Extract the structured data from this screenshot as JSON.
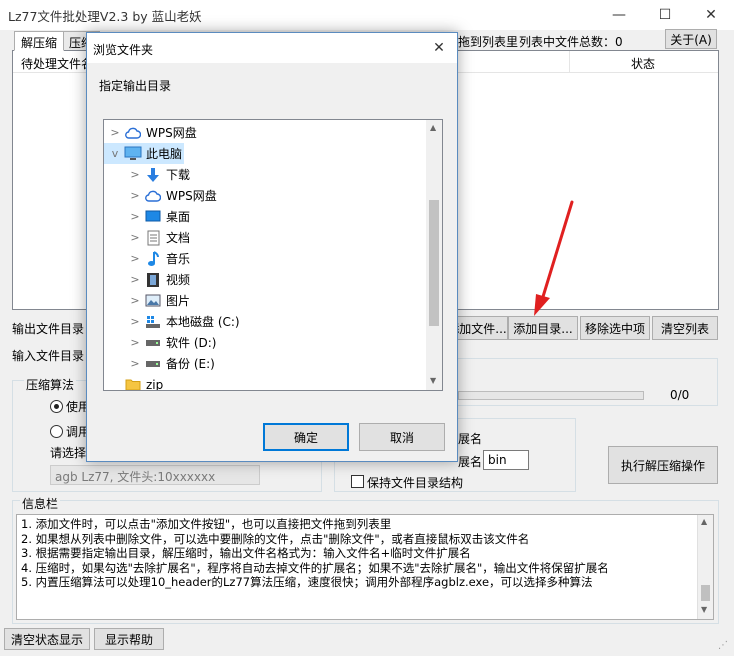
{
  "window": {
    "title": "Lz77文件批处理V2.3 by 蓝山老妖",
    "minimize_glyph": "—",
    "maximize_glyph": "☐",
    "close_glyph": "✕"
  },
  "tabs": [
    {
      "label": "解压缩"
    },
    {
      "label": "压缩"
    }
  ],
  "header": {
    "drag_hint": "拖到列表里",
    "count_label": "列表中文件总数：0",
    "about_label": "关于(A)"
  },
  "list": {
    "col_file": "待处理文件名",
    "col_status": "状态"
  },
  "buttons": {
    "add_file": "添加文件...",
    "add_dir": "添加目录...",
    "remove_selected": "移除选中项",
    "clear_list": "清空列表",
    "execute": "执行解压缩操作",
    "clear_status": "清空状态显示",
    "show_help": "显示帮助"
  },
  "labels": {
    "output_dir": "输出文件目录",
    "input_dir": "输入文件目录",
    "algorithm": "压缩算法",
    "use": "使用",
    "call": "调用",
    "please_select": "请选择",
    "progress": "0/0",
    "ext_name_1": "展名",
    "ext_name_2": "展名",
    "keep_structure": "保持文件目录结构",
    "info_title": "信息栏"
  },
  "inputs": {
    "ext_value": "bin",
    "algo_select": "agb Lz77, 文件头:10xxxxxx"
  },
  "info_lines": [
    "1. 添加文件时，可以点击\"添加文件按钮\"，也可以直接把文件拖到列表里",
    "2. 如果想从列表中删除文件，可以选中要删除的文件，点击\"删除文件\"，或者直接鼠标双击该文件名",
    "3. 根据需要指定输出目录，解压缩时，输出文件名格式为：输入文件名+临时文件扩展名",
    "4. 压缩时，如果勾选\"去除扩展名\"，程序将自动去掉文件的扩展名；如果不选\"去除扩展名\"，输出文件将保留扩展名",
    "5. 内置压缩算法可以处理10_header的Lz77算法压缩，速度很快；调用外部程序agblz.exe，可以选择多种算法"
  ],
  "dialog": {
    "title": "浏览文件夹",
    "close_glyph": "✕",
    "prompt": "指定输出目录",
    "ok_label": "确定",
    "cancel_label": "取消",
    "tree": [
      {
        "label": "WPS网盘",
        "icon": "cloud-icon",
        "level": 0,
        "expander": ">"
      },
      {
        "label": "此电脑",
        "icon": "computer-icon",
        "level": 0,
        "expander": "v",
        "selected": true
      },
      {
        "label": "下载",
        "icon": "download-icon",
        "level": 1,
        "expander": ">"
      },
      {
        "label": "WPS网盘",
        "icon": "cloud-icon",
        "level": 1,
        "expander": ">"
      },
      {
        "label": "桌面",
        "icon": "desktop-icon",
        "level": 1,
        "expander": ">"
      },
      {
        "label": "文档",
        "icon": "document-icon",
        "level": 1,
        "expander": ">"
      },
      {
        "label": "音乐",
        "icon": "music-icon",
        "level": 1,
        "expander": ">"
      },
      {
        "label": "视频",
        "icon": "video-icon",
        "level": 1,
        "expander": ">"
      },
      {
        "label": "图片",
        "icon": "picture-icon",
        "level": 1,
        "expander": ">"
      },
      {
        "label": "本地磁盘 (C:)",
        "icon": "system-drive-icon",
        "level": 1,
        "expander": ">"
      },
      {
        "label": "软件 (D:)",
        "icon": "drive-icon",
        "level": 1,
        "expander": ">"
      },
      {
        "label": "备份 (E:)",
        "icon": "drive-icon",
        "level": 1,
        "expander": ">"
      },
      {
        "label": "zip",
        "icon": "folder-icon",
        "level": 0,
        "expander": ""
      }
    ]
  },
  "colors": {
    "selection": "#cce8ff",
    "arrow": "#e02020",
    "accent_blue": "#0078d7"
  }
}
